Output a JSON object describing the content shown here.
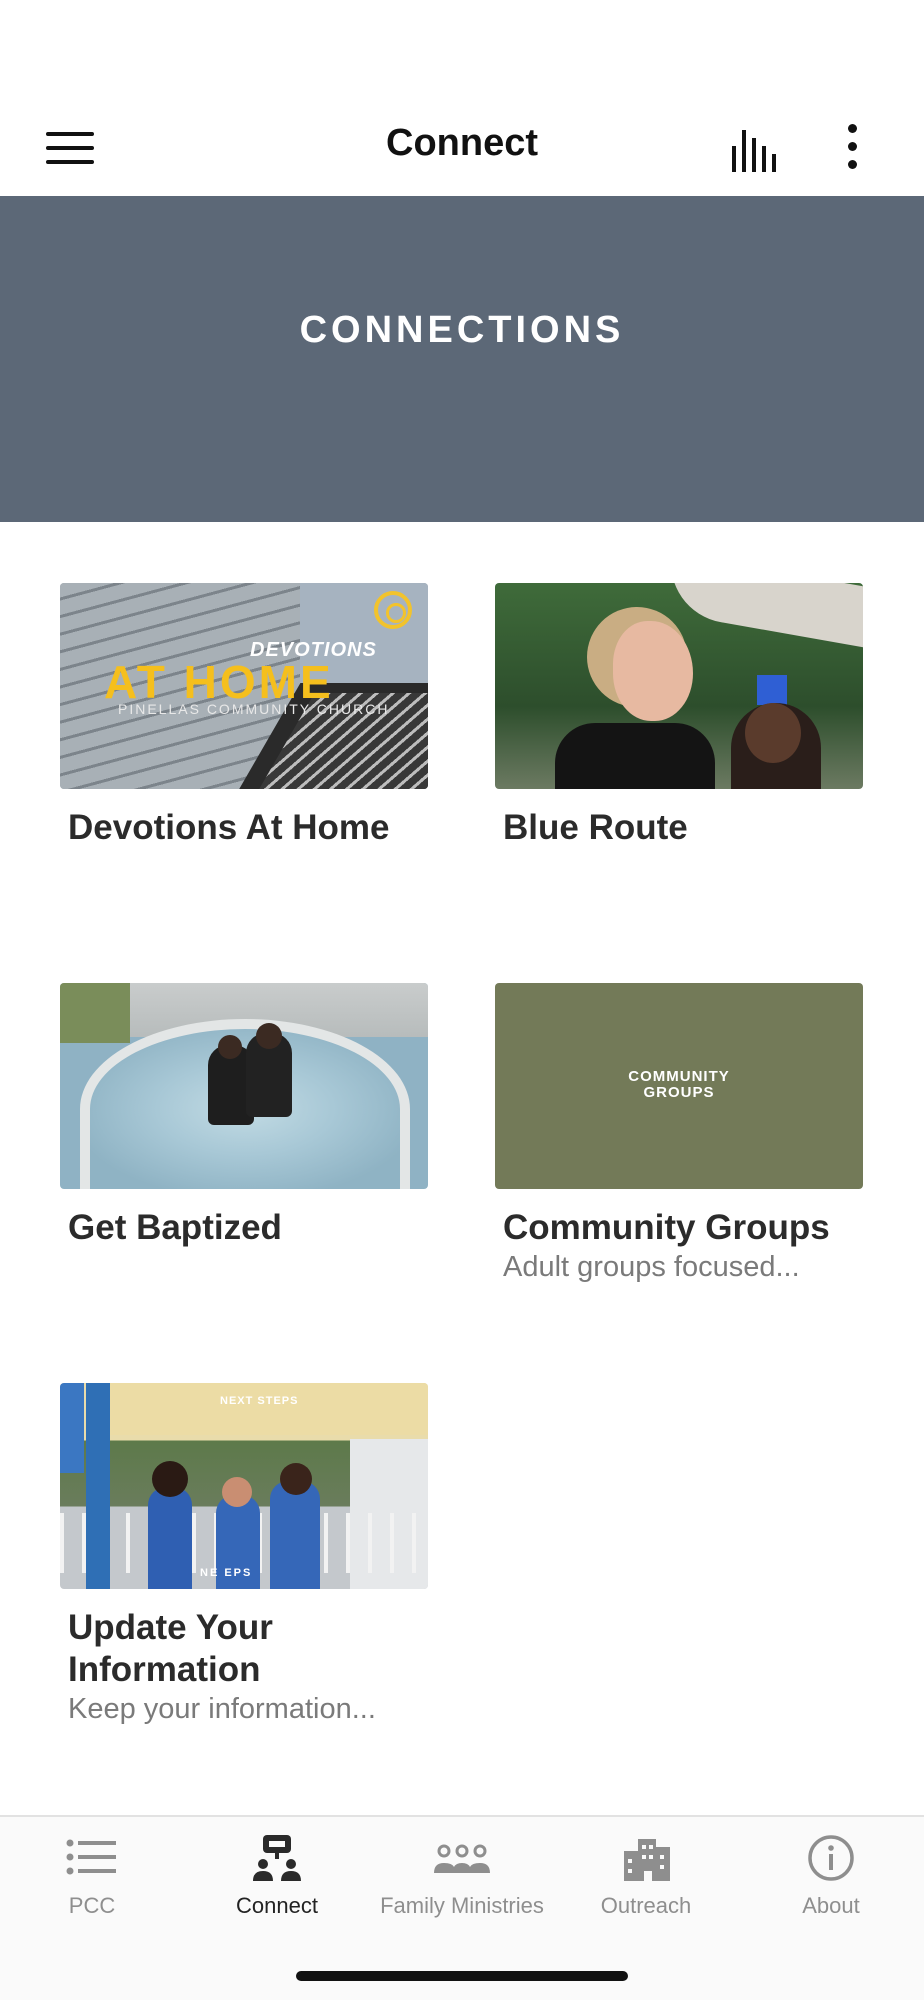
{
  "nav": {
    "title": "Connect",
    "menu_icon": "hamburger-menu-icon",
    "audio_icon": "audio-bars-icon",
    "more_icon": "more-vertical-icon"
  },
  "banner": {
    "title": "CONNECTIONS",
    "color": "#5c6877"
  },
  "cards": [
    {
      "title": "Devotions At Home",
      "subtitle": "",
      "thumb_text": {
        "line1": "DEVOTIONS",
        "line2": "AT HOME",
        "line3": "PINELLAS COMMUNITY CHURCH"
      }
    },
    {
      "title": "Blue Route",
      "subtitle": ""
    },
    {
      "title": "Get Baptized",
      "subtitle": ""
    },
    {
      "title": "Community Groups",
      "subtitle": "Adult groups focused...",
      "thumb_text": {
        "line1": "COMMUNITY",
        "line2": "GROUPS"
      }
    },
    {
      "title": "Update Your Information",
      "subtitle": "Keep your information...",
      "thumb_text": {
        "line1": "NEXT STEPS",
        "line2": "NE   EPS"
      }
    }
  ],
  "tabs": [
    {
      "label": "PCC",
      "icon": "list-icon",
      "active": false
    },
    {
      "label": "Connect",
      "icon": "connect-people-icon",
      "active": true
    },
    {
      "label": "Family Ministries",
      "icon": "group-people-icon",
      "active": false
    },
    {
      "label": "Outreach",
      "icon": "buildings-icon",
      "active": false
    },
    {
      "label": "About",
      "icon": "info-icon",
      "active": false
    }
  ],
  "colors": {
    "tab_active": "#222222",
    "tab_inactive": "#8e8e8e",
    "accent_yellow": "#f5bf1d",
    "community_green": "#737a58"
  }
}
